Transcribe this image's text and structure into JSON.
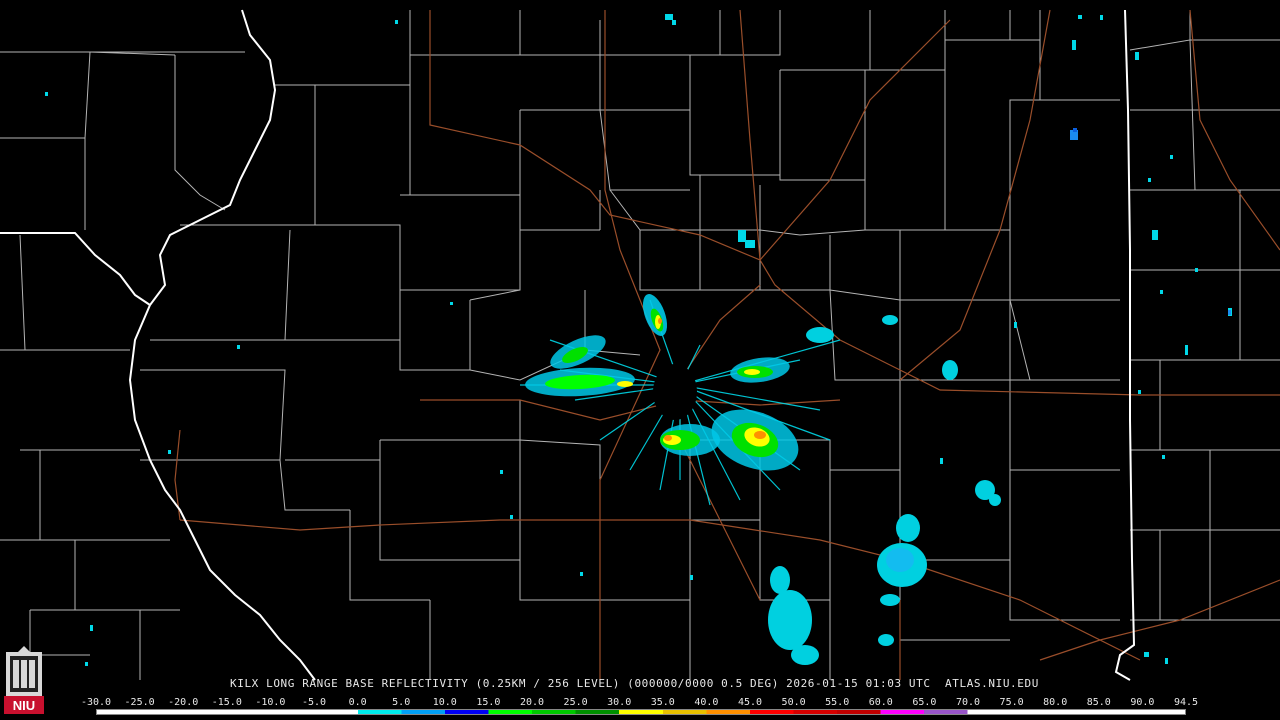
{
  "product": {
    "caption": "KILX LONG RANGE BASE REFLECTIVITY (0.25KM / 256 LEVEL) (000000/0000 0.5 DEG) 2026-01-15 01:03 UTC  ATLAS.NIU.EDU"
  },
  "logo": {
    "text": "NIU"
  },
  "scale": {
    "labels": [
      "-30.0",
      "-25.0",
      "-20.0",
      "-15.0",
      "-10.0",
      "-5.0",
      "0.0",
      "5.0",
      "10.0",
      "15.0",
      "20.0",
      "25.0",
      "30.0",
      "35.0",
      "40.0",
      "45.0",
      "50.0",
      "55.0",
      "60.0",
      "65.0",
      "70.0",
      "75.0",
      "80.0",
      "85.0",
      "90.0",
      "94.5"
    ],
    "colors": [
      "#ffffff",
      "#ffffff",
      "#ffffff",
      "#ffffff",
      "#ffffff",
      "#ffffff",
      "#00ecec",
      "#01a0f6",
      "#0000f6",
      "#00ff00",
      "#00c800",
      "#009000",
      "#ffff00",
      "#e7c000",
      "#ff9000",
      "#ff0000",
      "#d60000",
      "#c00000",
      "#ff00ff",
      "#9955c9",
      "#ffffff",
      "#ffffff",
      "#ffffff",
      "#ffffff",
      "#ffffff"
    ]
  },
  "colors": {
    "background": "#000000",
    "county_lines": "#b8b8b8",
    "state_lines": "#ffffff",
    "highways": "#a0522d"
  }
}
